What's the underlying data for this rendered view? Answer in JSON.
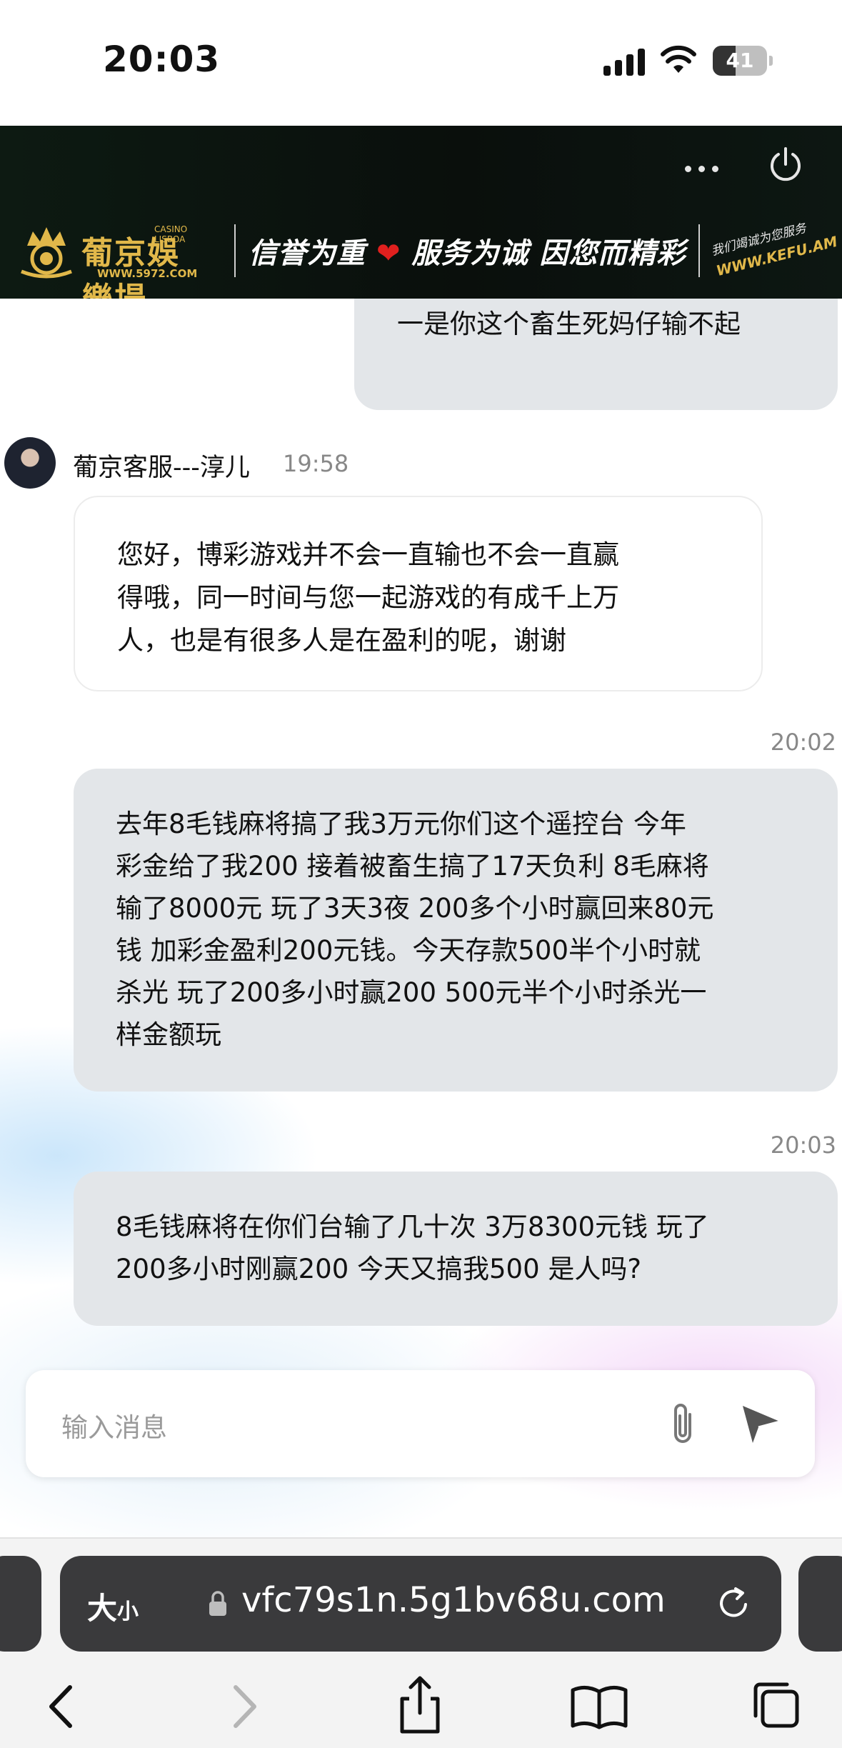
{
  "status_bar": {
    "time": "20:03",
    "battery": "41"
  },
  "banner": {
    "logo_cn": "葡京娛樂場",
    "logo_en": "CASINO LISBOA",
    "logo_url": "WWW.5972.COM",
    "slogan_part1": "信誉为重",
    "slogan_part2": "服务为诚  因您而精彩",
    "kefu_line1": "我们竭诚为您服务",
    "kefu_url": "WWW.KEFU.AM"
  },
  "chat": {
    "prev_message": "一是你这个畜生死妈仔输不起",
    "agent_name": "葡京客服---淳儿",
    "agent_time": "19:58",
    "agent_message_lines": [
      "您好，博彩游戏并不会一直输也不会一直赢",
      "得哦，同一时间与您一起游戏的有成千上万",
      "人，也是有很多人是在盈利的呢，谢谢"
    ],
    "msg2_time": "20:02",
    "msg2_lines": [
      "去年8毛钱麻将搞了我3万元你们这个遥控台 今年",
      "彩金给了我200 接着被畜生搞了17天负利 8毛麻将",
      "输了8000元 玩了3天3夜 200多个小时赢回来80元",
      "钱 加彩金盈利200元钱。今天存款500半个小时就",
      "杀光 玩了200多小时赢200 500元半个小时杀光一",
      "样金额玩"
    ],
    "msg3_time": "20:03",
    "msg3_lines": [
      "8毛钱麻将在你们台输了几十次 3万8300元钱 玩了",
      "200多小时刚赢200 今天又搞我500 是人吗?"
    ]
  },
  "input": {
    "placeholder": "输入消息"
  },
  "browser": {
    "text_size_label_big": "大",
    "text_size_label_small": "小",
    "url": "vfc79s1n.5g1bv68u.com"
  },
  "colors": {
    "user_bubble": "#e3e6e9",
    "banner_gold": "#e1b84a",
    "heart_red": "#e0201e",
    "address_bar": "#3a3a3c"
  }
}
